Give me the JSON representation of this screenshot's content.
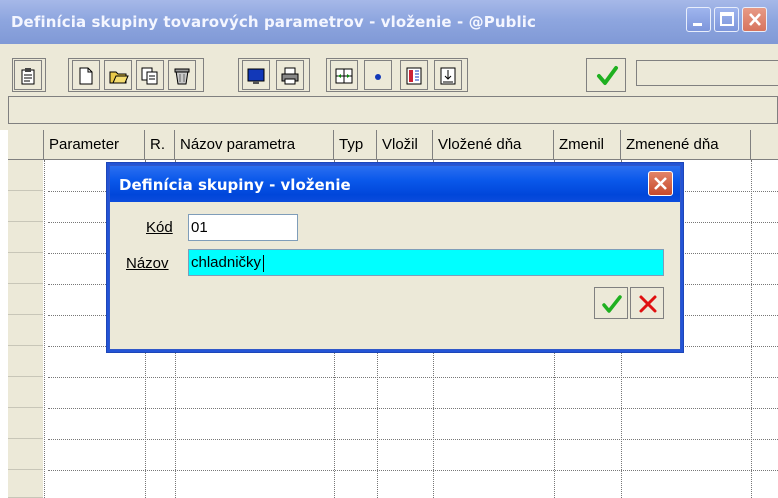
{
  "window": {
    "title": "Definícia skupiny tovarových parametrov - vloženie - @Public"
  },
  "toolbar": {
    "buttons": [
      "clipboard-icon",
      "new-document-icon",
      "open-folder-icon",
      "copy-icon",
      "delete-icon",
      "monitor-icon",
      "print-icon",
      "fit-columns-icon",
      "dot-icon",
      "layout-icon",
      "import-icon"
    ],
    "confirm_icon": "checkmark-icon",
    "accent_green": "#1fb020"
  },
  "grid": {
    "columns": [
      "Parameter",
      "R.",
      "Názov parametra",
      "Typ",
      "Vložil",
      "Vložené dňa",
      "Zmenil",
      "Zmenené dňa"
    ]
  },
  "dialog": {
    "title": "Definícia skupiny - vloženie",
    "code_label": "Kód",
    "code_value": "01",
    "name_label": "Názov",
    "name_value": "chladničky",
    "active_field_color": "#00ffff",
    "ok_icon": "checkmark-icon",
    "cancel_icon": "cross-icon"
  }
}
